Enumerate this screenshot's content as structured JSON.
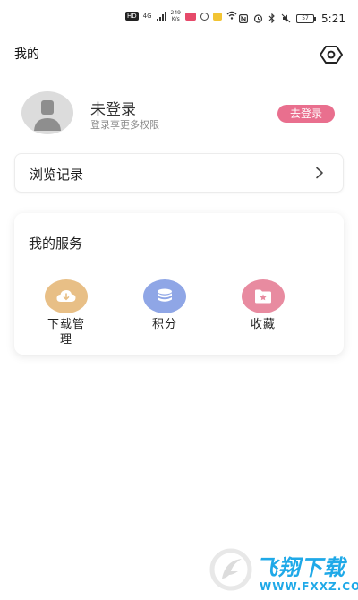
{
  "status_bar": {
    "network_badge": "HD",
    "network_type": "4G",
    "speed_value": "249",
    "speed_unit": "K/s",
    "battery": "57",
    "time": "5:21"
  },
  "header": {
    "title": "我的"
  },
  "profile": {
    "name": "未登录",
    "subtitle": "登录享更多权限",
    "login_button": "去登录"
  },
  "history": {
    "label": "浏览记录"
  },
  "services": {
    "title": "我的服务",
    "items": [
      {
        "label": "下载管理",
        "icon": "cloud-download-icon",
        "color": "#e8bf86"
      },
      {
        "label": "积分",
        "icon": "coin-stack-icon",
        "color": "#8fa6e6"
      },
      {
        "label": "收藏",
        "icon": "star-folder-icon",
        "color": "#e88ba0"
      }
    ]
  },
  "watermark": {
    "brand": "飞翔下载",
    "url": "WWW.FXXZ.COM"
  },
  "colors": {
    "accent_pink": "#e96f8e",
    "watermark_blue": "#1fa9e8"
  }
}
